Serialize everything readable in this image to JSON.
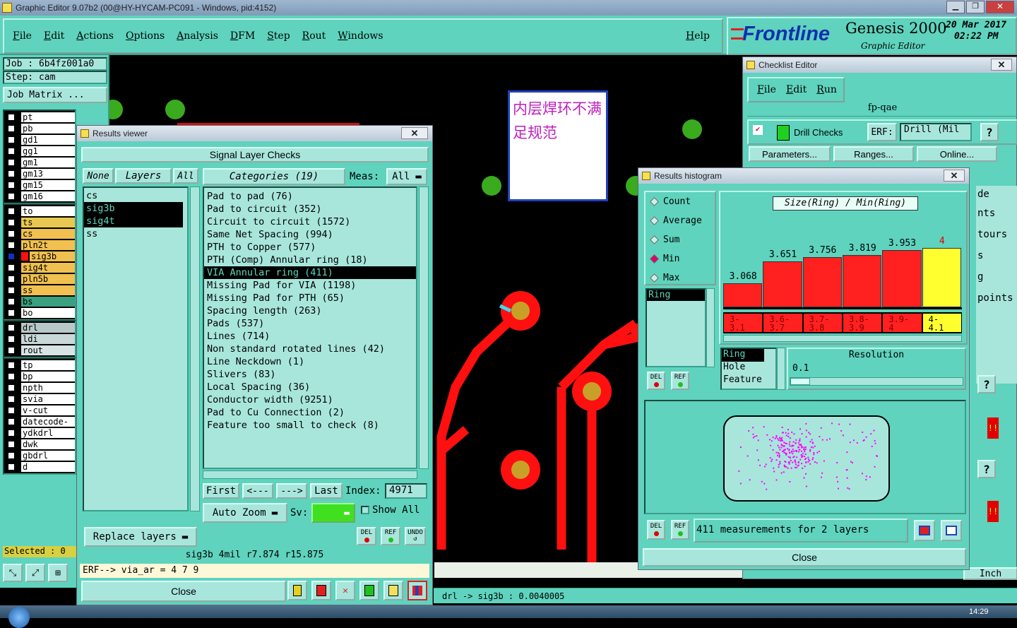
{
  "window": {
    "title": "Graphic Editor 9.07b2 (00@HY-HYCAM-PC091 - Windows, pid:4152)"
  },
  "menu": {
    "items": [
      "File",
      "Edit",
      "Actions",
      "Options",
      "Analysis",
      "DFM",
      "Step",
      "Rout",
      "Windows"
    ],
    "help": "Help"
  },
  "brand": {
    "logo": "Frontline",
    "product": "Genesis 2000",
    "subtitle": "Graphic Editor",
    "date": "20 Mar 2017",
    "time": "02:22 PM"
  },
  "job": {
    "job": "Job : 6b4fz001a0",
    "step": "Step: cam",
    "matrix_button": "Job Matrix ..."
  },
  "layers": {
    "group1": [
      {
        "name": "pt",
        "color": "#ffffff"
      },
      {
        "name": "pb",
        "color": "#ffffff"
      },
      {
        "name": "gd1",
        "color": "#ffffff"
      },
      {
        "name": "gg1",
        "color": "#ffffff"
      },
      {
        "name": "gm1",
        "color": "#ffffff"
      },
      {
        "name": "gm13",
        "color": "#ffffff"
      },
      {
        "name": "gm15",
        "color": "#ffffff"
      },
      {
        "name": "gm16",
        "color": "#ffffff"
      }
    ],
    "group2": [
      {
        "name": "to",
        "color": "#ffffff"
      },
      {
        "name": "ts",
        "color": "#e8c850"
      },
      {
        "name": "cs",
        "color": "#f0c050"
      },
      {
        "name": "pln2t",
        "color": "#f0c050"
      },
      {
        "name": "sig3b",
        "color": "#f0c050"
      },
      {
        "name": "sig4t",
        "color": "#f0c050"
      },
      {
        "name": "pln5b",
        "color": "#f0c050"
      },
      {
        "name": "ss",
        "color": "#f0c050"
      },
      {
        "name": "bs",
        "color": "#3aa080"
      },
      {
        "name": "bo",
        "color": "#ffffff"
      }
    ],
    "group3": [
      {
        "name": "drl",
        "color": "#b8c8c8"
      },
      {
        "name": "ldi",
        "color": "#c8d8d8"
      },
      {
        "name": "rout",
        "color": "#d8e4e4"
      }
    ],
    "group4": [
      {
        "name": "tp",
        "color": "#ffffff"
      },
      {
        "name": "bp",
        "color": "#ffffff"
      },
      {
        "name": "npth",
        "color": "#ffffff"
      },
      {
        "name": "svia",
        "color": "#ffffff"
      },
      {
        "name": "v-cut",
        "color": "#ffffff"
      },
      {
        "name": "datecode-",
        "color": "#ffffff"
      },
      {
        "name": "ydkdrl",
        "color": "#ffffff"
      },
      {
        "name": "dwk",
        "color": "#ffffff"
      },
      {
        "name": "gbdrl",
        "color": "#ffffff"
      },
      {
        "name": "d",
        "color": "#ffffff"
      }
    ],
    "selected_count": "Selected : 0"
  },
  "annotation": {
    "text": "内层焊环不满足规范"
  },
  "results_viewer": {
    "title": "Results viewer",
    "header": "Signal Layer Checks",
    "none_button": "None",
    "layers_label": "Layers",
    "all_button": "All",
    "layer_list": [
      "cs",
      "sig3b",
      "sig4t",
      "ss"
    ],
    "categories_label": "Categories (19)",
    "meas_label": "Meas:",
    "meas_value": "All",
    "categories": [
      "Pad to pad (76)",
      "Pad to circuit (352)",
      "Circuit to circuit (1572)",
      "Same Net Spacing (994)",
      "PTH to Copper (577)",
      "PTH (Comp) Annular ring (18)",
      "VIA Annular ring (411)",
      "Missing Pad for VIA (1198)",
      "Missing Pad for PTH (65)",
      "Spacing length (263)",
      "Pads (537)",
      "Lines (714)",
      "Non standard rotated lines (42)",
      "Line Neckdown (1)",
      "Slivers (83)",
      "Local Spacing (36)",
      "Conductor width (9251)",
      "Pad to Cu Connection (2)",
      "Feature too small to check (8)"
    ],
    "selected_category": "VIA Annular ring (411)",
    "nav": {
      "first": "First",
      "prev": "<---",
      "next": "--->",
      "last": "Last",
      "index_label": "Index:",
      "index_value": "4971"
    },
    "auto_zoom": "Auto Zoom",
    "sv_label": "Sv:",
    "show_all": "Show All",
    "replace_layers": "Replace layers",
    "del": "DEL",
    "ref": "REF",
    "undo": "UNDO",
    "info": "sig3b 4mil  r7.874  r15.875",
    "erf": "ERF--> via_ar = 4 7 9",
    "close": "Close"
  },
  "checklist": {
    "title": "Checklist Editor",
    "menu": [
      "File",
      "Edit",
      "Run"
    ],
    "name": "fp-qae",
    "action": "Drill Checks",
    "erf_label": "ERF:",
    "erf_value": "Drill (Mil",
    "help": "?",
    "buttons": [
      "Parameters...",
      "Ranges...",
      "Online..."
    ],
    "partial": [
      "de",
      "nts",
      "tours",
      "s",
      "g",
      "points"
    ],
    "units": "Inch"
  },
  "histogram": {
    "title": "Results histogram",
    "options": [
      "Count",
      "Average",
      "Sum",
      "Min",
      "Max"
    ],
    "selected_option": "Min",
    "chart_title": "Size(Ring) / Min(Ring)",
    "list1": [
      "Ring"
    ],
    "list2": [
      "Ring",
      "Hole",
      "Feature"
    ],
    "resolution_label": "Resolution",
    "resolution_value": "0.1",
    "summary": "411 measurements for 2 layers",
    "close": "Close",
    "del": "DEL",
    "ref": "REF"
  },
  "chart_data": {
    "type": "bar",
    "title": "Size(Ring) / Min(Ring)",
    "categories": [
      "3-\n3.1",
      "3.6-\n3.7",
      "3.7-\n3.8",
      "3.8-\n3.9",
      "3.9-\n4",
      "4-\n4.1"
    ],
    "series": [
      {
        "values": [
          3.068,
          3.651,
          3.756,
          3.819,
          3.953,
          4
        ]
      }
    ],
    "colors": [
      "#ff2020",
      "#ff2020",
      "#ff2020",
      "#ff2020",
      "#ff2020",
      "#ffff30"
    ]
  },
  "status": {
    "readout": "drl -> sig3b : 0.0040005",
    "clock": "14:29"
  }
}
